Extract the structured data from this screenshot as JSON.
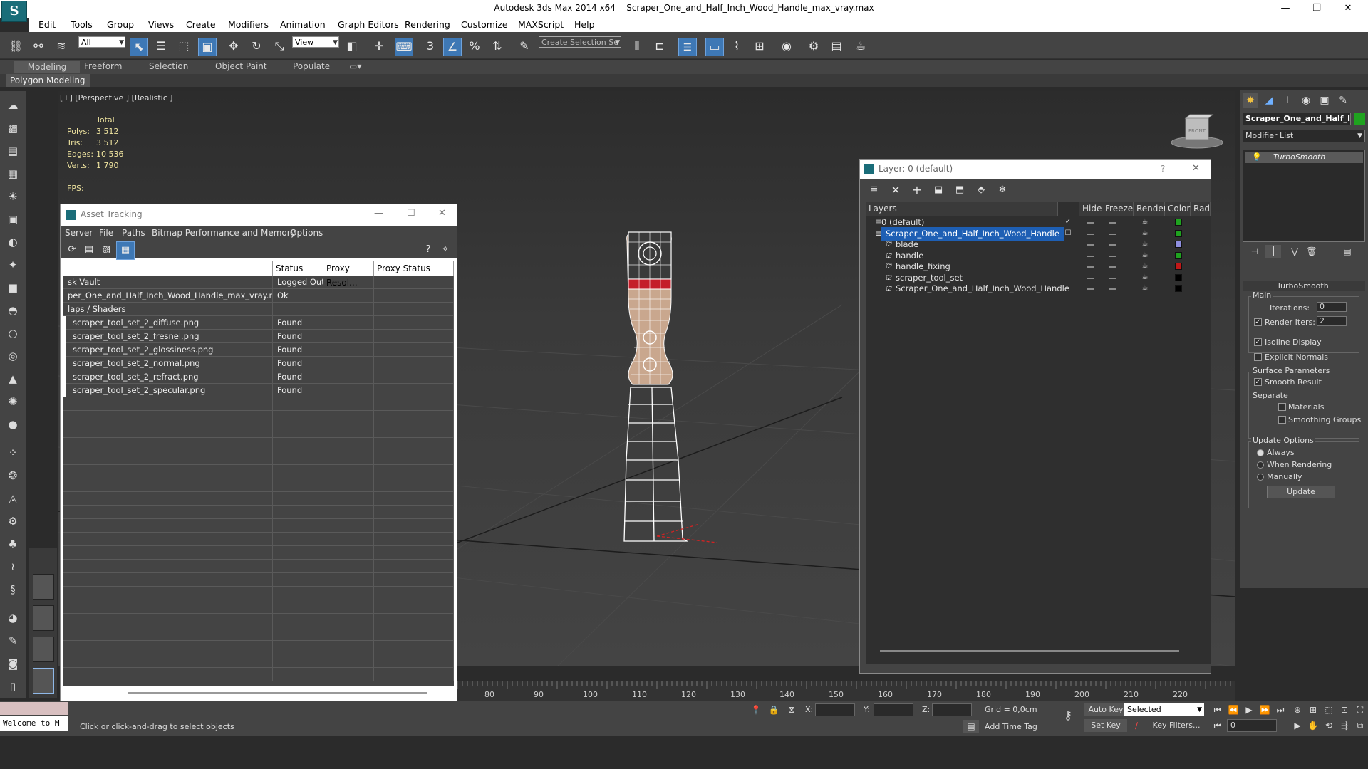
{
  "window": {
    "app_title": "Autodesk 3ds Max  2014 x64",
    "file_title": "Scraper_One_and_Half_Inch_Wood_Handle_max_vray.max",
    "minimize": "—",
    "maximize": "❐",
    "close": "✕"
  },
  "menubar": [
    "Edit",
    "Tools",
    "Group",
    "Views",
    "Create",
    "Modifiers",
    "Animation",
    "Graph Editors",
    "Rendering",
    "Customize",
    "MAXScript",
    "Help"
  ],
  "toolbar": {
    "selection_filter": "All",
    "ref_coord": "View",
    "named_selection": "Create Selection Se"
  },
  "ribbon": {
    "tabs": [
      "Modeling",
      "Freeform",
      "Selection",
      "Object Paint",
      "Populate"
    ],
    "sub_tab": "Polygon Modeling"
  },
  "viewport": {
    "label": "[+] [Perspective ] [Realistic ]",
    "stats_header": "Total",
    "stats": [
      {
        "label": "Polys:",
        "value": "3 512"
      },
      {
        "label": "Tris:",
        "value": "3 512"
      },
      {
        "label": "Edges:",
        "value": "10 536"
      },
      {
        "label": "Verts:",
        "value": "1 790"
      }
    ],
    "fps_label": "FPS:",
    "viewcube_text": "FRONT"
  },
  "asset_tracking": {
    "title": "Asset Tracking",
    "menus": [
      "Server",
      "File",
      "Paths",
      "Bitmap Performance and Memory",
      "Options"
    ],
    "columns": [
      "",
      "Status",
      "Proxy Resol...",
      "Proxy Status"
    ],
    "rows": [
      {
        "name": "sk Vault",
        "status": "Logged Out ..."
      },
      {
        "name": "per_One_and_Half_Inch_Wood_Handle_max_vray.max",
        "status": "Ok"
      },
      {
        "name": "laps / Shaders",
        "status": ""
      },
      {
        "name": "scraper_tool_set_2_diffuse.png",
        "status": "Found"
      },
      {
        "name": "scraper_tool_set_2_fresnel.png",
        "status": "Found"
      },
      {
        "name": "scraper_tool_set_2_glossiness.png",
        "status": "Found"
      },
      {
        "name": "scraper_tool_set_2_normal.png",
        "status": "Found"
      },
      {
        "name": "scraper_tool_set_2_refract.png",
        "status": "Found"
      },
      {
        "name": "scraper_tool_set_2_specular.png",
        "status": "Found"
      }
    ]
  },
  "layer_panel": {
    "title": "Layer: 0 (default)",
    "help": "?",
    "columns": [
      "Layers",
      "Hide",
      "Freeze",
      "Render",
      "Color",
      "Rad"
    ],
    "rows": [
      {
        "name": "0 (default)",
        "indent": 0,
        "color": "#1fa31f",
        "selected": false,
        "current": true
      },
      {
        "name": "Scraper_One_and_Half_Inch_Wood_Handle",
        "indent": 0,
        "color": "#1fa31f",
        "selected": true,
        "current": false
      },
      {
        "name": "blade",
        "indent": 1,
        "color": "#8f8fe0",
        "selected": false,
        "current": false
      },
      {
        "name": "handle",
        "indent": 1,
        "color": "#1fa31f",
        "selected": false,
        "current": false
      },
      {
        "name": "handle_fixing",
        "indent": 1,
        "color": "#c01818",
        "selected": false,
        "current": false
      },
      {
        "name": "scraper_tool_set",
        "indent": 1,
        "color": "#000000",
        "selected": false,
        "current": false
      },
      {
        "name": "Scraper_One_and_Half_Inch_Wood_Handle",
        "indent": 1,
        "color": "#000000",
        "selected": false,
        "current": false
      }
    ]
  },
  "command_panel": {
    "object_name": "Scraper_One_and_Half_I",
    "object_color": "#1fa31f",
    "modifier_list": "Modifier List",
    "stack_item": "TurboSmooth",
    "rollout_title": "TurboSmooth",
    "main_label": "Main",
    "iterations_label": "Iterations:",
    "iterations_value": "0",
    "render_iters_label": "Render Iters:",
    "render_iters_value": "2",
    "isoline_label": "Isoline Display",
    "explicit_label": "Explicit Normals",
    "surface_label": "Surface Parameters",
    "smooth_label": "Smooth Result",
    "separate_label": "Separate",
    "materials_label": "Materials",
    "smoothing_groups_label": "Smoothing Groups",
    "update_options_label": "Update Options",
    "always_label": "Always",
    "when_rendering_label": "When Rendering",
    "manually_label": "Manually",
    "update_button": "Update"
  },
  "timeline": {
    "ticks": [
      "80",
      "90",
      "100",
      "110",
      "120",
      "130",
      "140",
      "150",
      "160",
      "170",
      "180",
      "190",
      "200",
      "210",
      "220"
    ]
  },
  "status": {
    "maxscript": "Welcome to M",
    "prompt": "Click or click-and-drag to select objects",
    "x_label": "X:",
    "y_label": "Y:",
    "z_label": "Z:",
    "grid": "Grid = 0,0cm",
    "add_time_tag": "Add Time Tag",
    "auto_key": "Auto Key",
    "set_key": "Set Key",
    "selected": "Selected",
    "key_filters": "Key Filters...",
    "frame": "0"
  }
}
